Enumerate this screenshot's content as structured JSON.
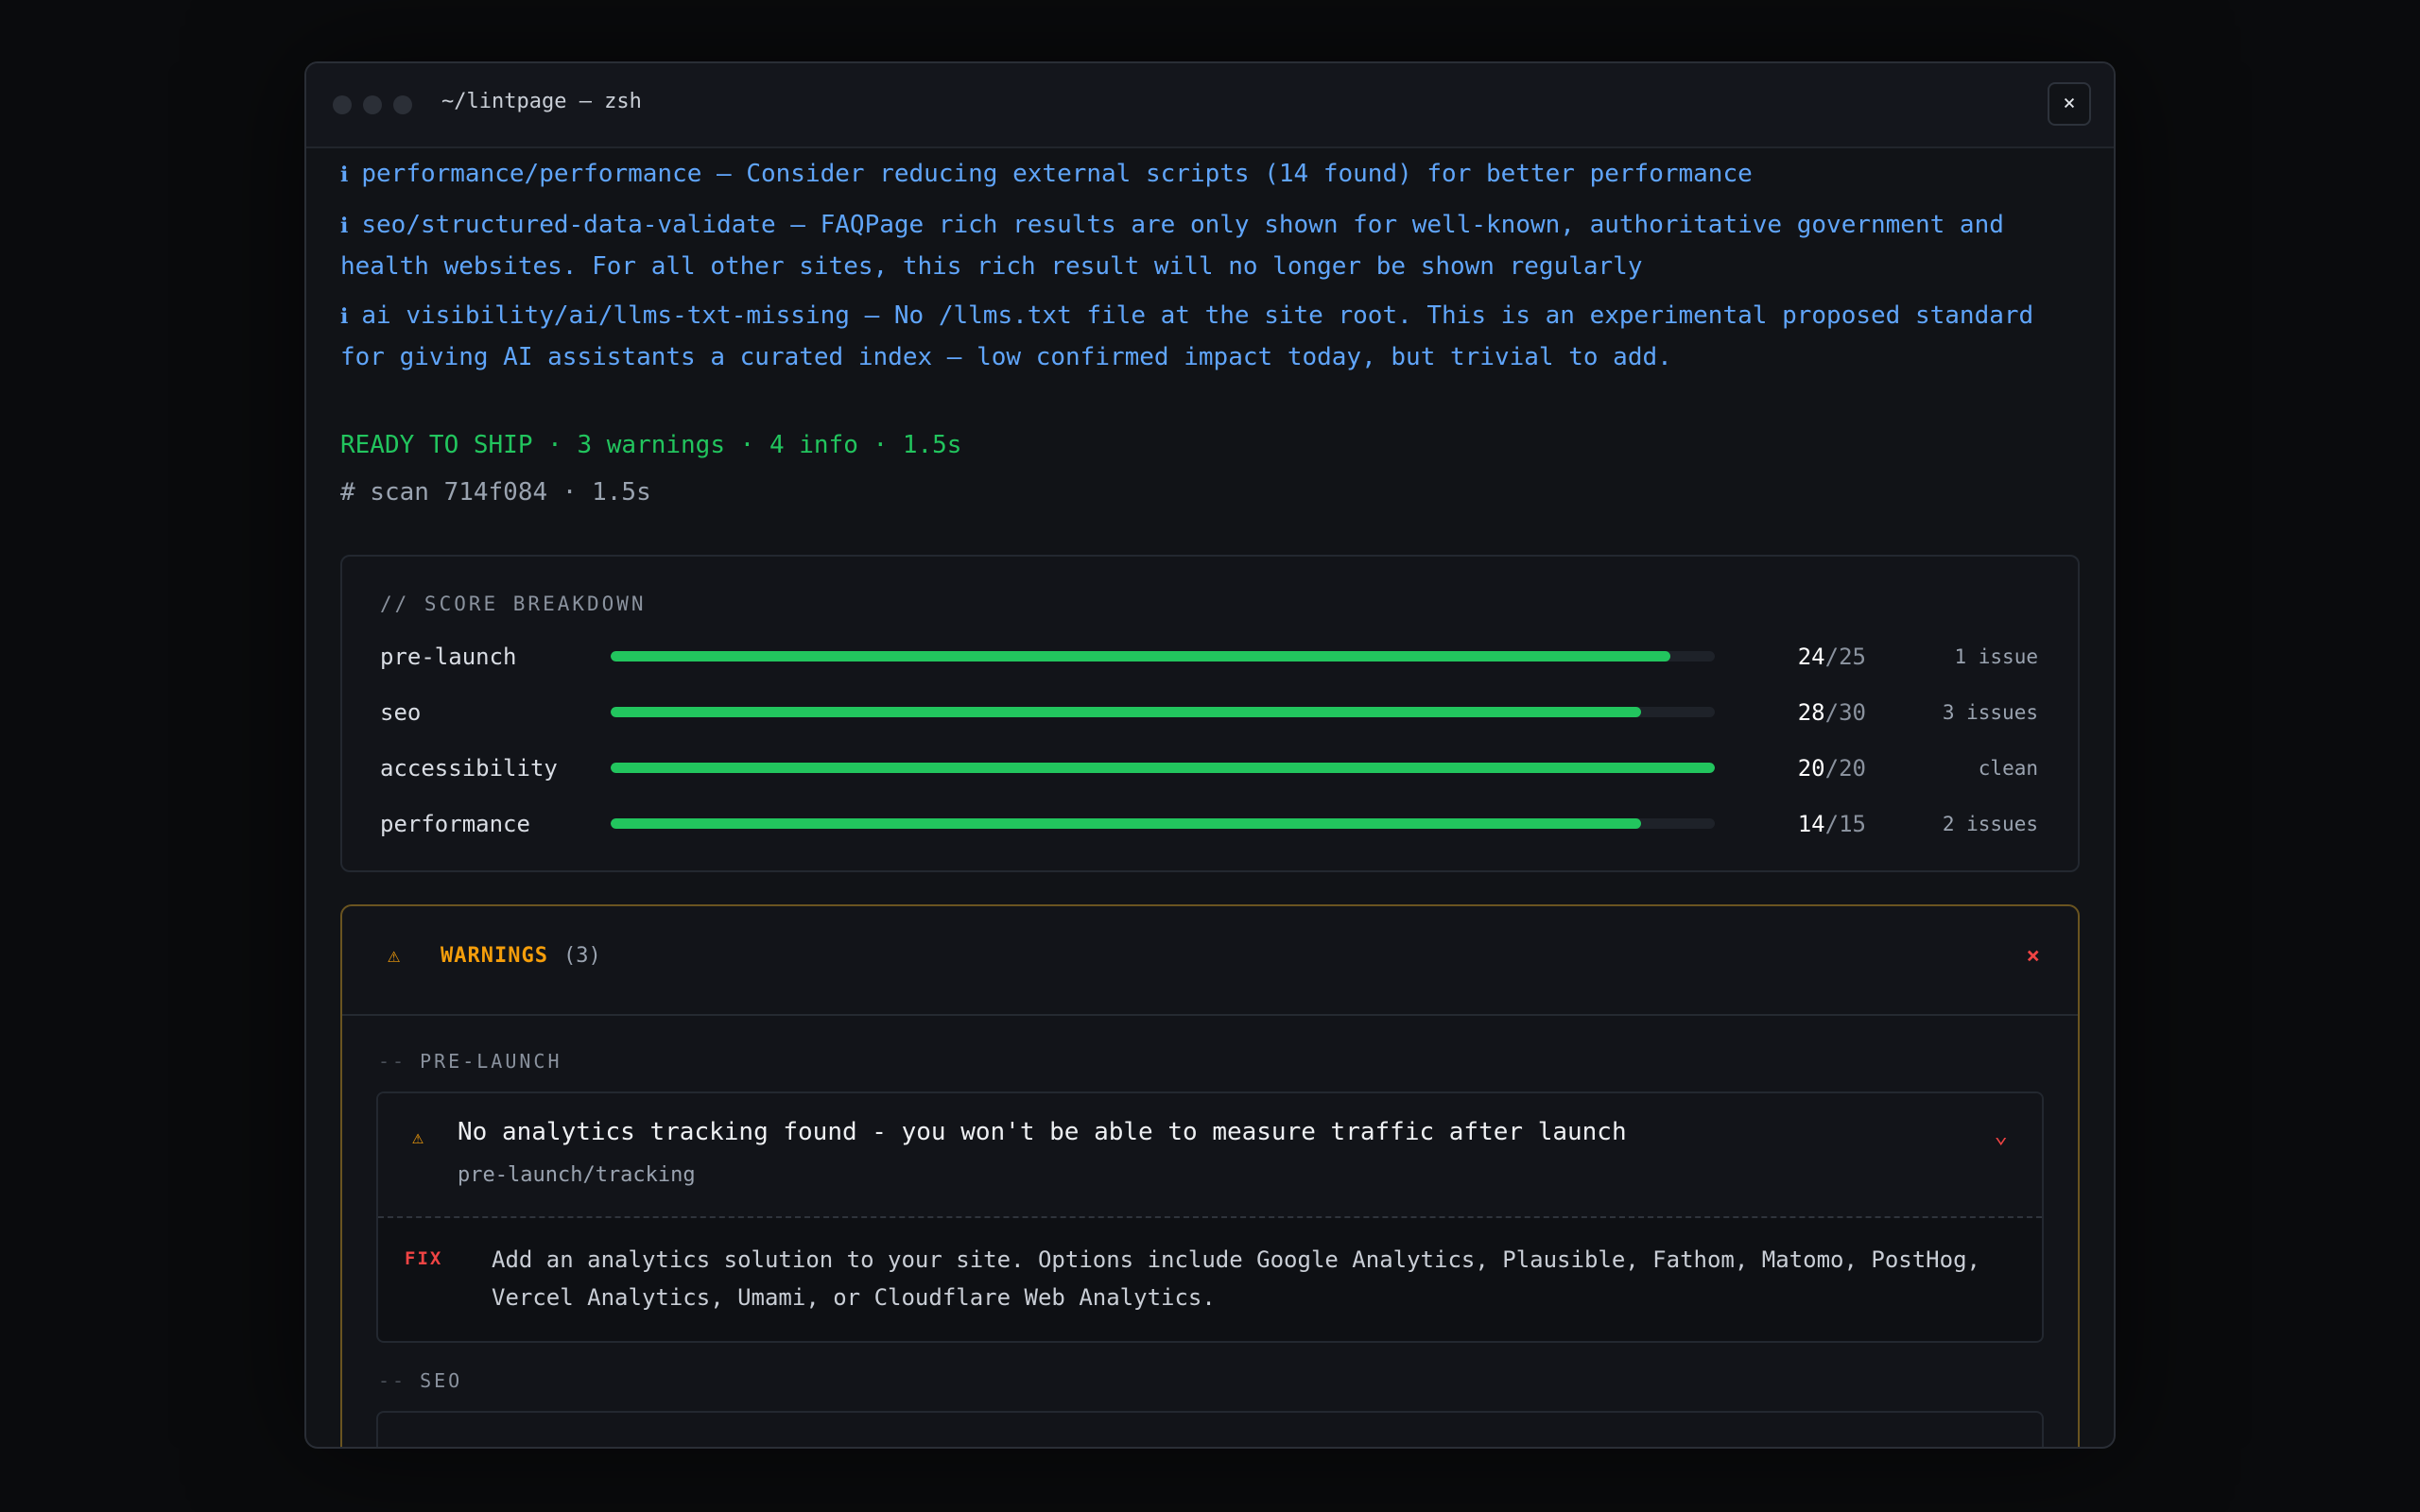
{
  "window": {
    "title": "~/lintpage — zsh",
    "close_label": "×"
  },
  "info_lines": [
    {
      "icon": "ℹ",
      "text": "performance/performance — Consider reducing external scripts (14 found) for better performance"
    },
    {
      "icon": "ℹ",
      "text": "seo/structured-data-validate — FAQPage rich results are only shown for well-known, authoritative government and health websites. For all other sites, this rich result will no longer be shown regularly"
    },
    {
      "icon": "ℹ",
      "text": "ai visibility/ai/llms-txt-missing — No /llms.txt file at the site root. This is an experimental proposed standard for giving AI assistants a curated index — low confirmed impact today, but trivial to add."
    }
  ],
  "status": {
    "ready": "READY TO SHIP · 3 warnings · 4 info · 1.5s",
    "scan": "# scan 714f084 · 1.5s"
  },
  "breakdown": {
    "title": "// SCORE BREAKDOWN",
    "rows": [
      {
        "label": "pre-launch",
        "score": 24,
        "max": 25,
        "score_text": "24",
        "max_text": "/25",
        "issues": "1 issue"
      },
      {
        "label": "seo",
        "score": 28,
        "max": 30,
        "score_text": "28",
        "max_text": "/30",
        "issues": "3 issues"
      },
      {
        "label": "accessibility",
        "score": 20,
        "max": 20,
        "score_text": "20",
        "max_text": "/20",
        "issues": "clean"
      },
      {
        "label": "performance",
        "score": 14,
        "max": 15,
        "score_text": "14",
        "max_text": "/15",
        "issues": "2 issues"
      }
    ],
    "bar_color": "#22c55e"
  },
  "warnings": {
    "icon": "⚠",
    "title": "WARNINGS",
    "count": "(3)",
    "close": "×",
    "groups": [
      {
        "dash": "--",
        "label": "PRE-LAUNCH",
        "issue": {
          "icon": "⚠",
          "title": "No analytics tracking found - you won't be able to measure traffic after launch",
          "rule": "pre-launch/tracking",
          "chevron": "⌄",
          "fix_tag": "FIX",
          "fix_text": "Add an analytics solution to your site. Options include Google Analytics, Plausible, Fathom, Matomo, PostHog, Vercel Analytics, Umami, or Cloudflare Web Analytics."
        }
      },
      {
        "dash": "--",
        "label": "SEO"
      }
    ]
  },
  "colors": {
    "info": "#60a5fa",
    "ready": "#22c55e",
    "warning": "#f59e0b",
    "error": "#ef4444"
  }
}
